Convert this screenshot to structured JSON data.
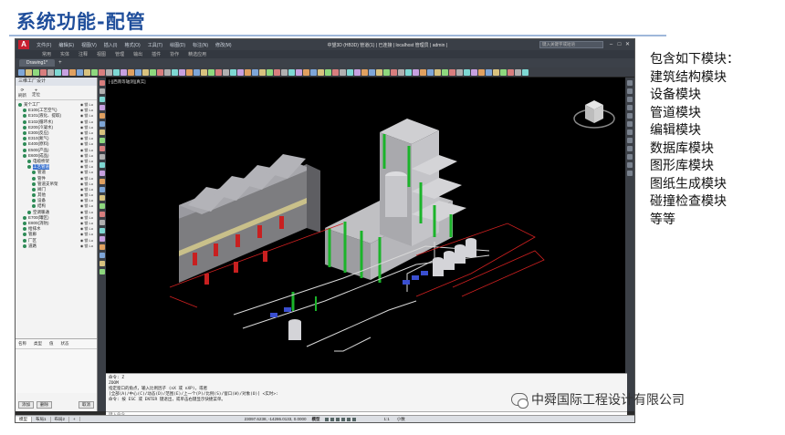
{
  "slide": {
    "title": "系统功能-配管"
  },
  "app": {
    "logo": "A",
    "menu": [
      "文件(F)",
      "编辑(E)",
      "视图(V)",
      "插入(I)",
      "格式(O)",
      "工具(T)",
      "绘图(D)",
      "标注(N)",
      "修改(M)"
    ],
    "window_title": "中望3D (HB3D) 管道(1) | 已连接 | localhost 管理员 | admin |",
    "search_placeholder": "键入关键字或短语",
    "ribbon_tabs": [
      "常用",
      "实体",
      "注释",
      "视图",
      "管理",
      "输出",
      "插件",
      "协作",
      "精选应用"
    ],
    "doc_tab": "Drawing1*",
    "doc_tab_add": "+",
    "viewport_label": "[-][西南等轴测][真实]",
    "left_panel": {
      "title": "三维工厂设计",
      "tools": [
        "刷新",
        "定位"
      ],
      "tree": [
        {
          "label": "某个工厂",
          "indent": 0,
          "color": "#2e8b57"
        },
        {
          "label": "E100(工艺空气)",
          "indent": 1,
          "color": "#2e8b57"
        },
        {
          "label": "E101(液化、提取)",
          "indent": 1,
          "color": "#2e8b57"
        },
        {
          "label": "E102(循环水)",
          "indent": 1,
          "color": "#2e8b57"
        },
        {
          "label": "E200(冷凝水)",
          "indent": 1,
          "color": "#2e8b57"
        },
        {
          "label": "E300(反应)",
          "indent": 1,
          "color": "#2e8b57"
        },
        {
          "label": "E310(氮气)",
          "indent": 1,
          "color": "#2e8b57"
        },
        {
          "label": "E400(原料)",
          "indent": 1,
          "color": "#2e8b57"
        },
        {
          "label": "E500(产品)",
          "indent": 1,
          "color": "#2e8b57"
        },
        {
          "label": "E600(成品)",
          "indent": 1,
          "color": "#2e8b57"
        },
        {
          "label": "电缆桥架",
          "indent": 2,
          "color": "#2e8b57"
        },
        {
          "label": "工艺管道",
          "indent": 2,
          "color": "#2e8b57",
          "selected": true
        },
        {
          "label": "管道",
          "indent": 3,
          "color": "#2e8b57"
        },
        {
          "label": "管件",
          "indent": 3,
          "color": "#2e8b57"
        },
        {
          "label": "管道支吊架",
          "indent": 3,
          "color": "#2e8b57"
        },
        {
          "label": "阀门",
          "indent": 3,
          "color": "#2e8b57"
        },
        {
          "label": "其他",
          "indent": 3,
          "color": "#2e8b57"
        },
        {
          "label": "设备",
          "indent": 3,
          "color": "#2e8b57"
        },
        {
          "label": "结构",
          "indent": 3,
          "color": "#2e8b57"
        },
        {
          "label": "空调暖通",
          "indent": 2,
          "color": "#2e8b57"
        },
        {
          "label": "E700(罐区)",
          "indent": 1,
          "color": "#2e8b57"
        },
        {
          "label": "E800(消防)",
          "indent": 1,
          "color": "#2e8b57"
        },
        {
          "label": "给排水",
          "indent": 1,
          "color": "#2e8b57"
        },
        {
          "label": "管廊",
          "indent": 1,
          "color": "#2e8b57"
        },
        {
          "label": "厂区",
          "indent": 1,
          "color": "#2e8b57"
        },
        {
          "label": "道路",
          "indent": 1,
          "color": "#2e8b57"
        }
      ],
      "eye_text": "◉ 锁 Lu",
      "props_head": [
        "名称",
        "类型",
        "值",
        "状态"
      ],
      "bottom_buttons": [
        "添加",
        "删除",
        "取消"
      ]
    },
    "command_lines": [
      "命令: Z",
      "ZOOM",
      "指定窗口的角点，输入比例因子 (nX 或 nXP)，或者",
      "[全部(A)/中心(C)/动态(D)/范围(E)/上一个(P)/比例(S)/窗口(W)/对象(O)] <实时>:",
      "命令:  按 ESC 或 ENTER 键退出，或单击右键显示快捷菜单。"
    ],
    "command_placeholder": "键入命令",
    "status": {
      "layout_tabs": [
        "模型",
        "布局1",
        "布局2",
        "+"
      ],
      "coords": "23097.6238, -14286.0133, 0.0000",
      "mode": "模型",
      "scale": "1:1",
      "small": "小数"
    }
  },
  "modules": {
    "heading": "包含如下模块：",
    "items": [
      "建筑结构模块",
      "设备模块",
      "管道模块",
      "编辑模块",
      "数据库模块",
      "图形库模块",
      "图纸生成模块",
      "碰撞检查模块",
      "等等"
    ]
  },
  "watermark": {
    "text": "中舜国际工程设计有限公司"
  },
  "colors": {
    "title": "#1f4e9b",
    "viewport_bg": "#000000",
    "accent_red": "#c8202f"
  }
}
